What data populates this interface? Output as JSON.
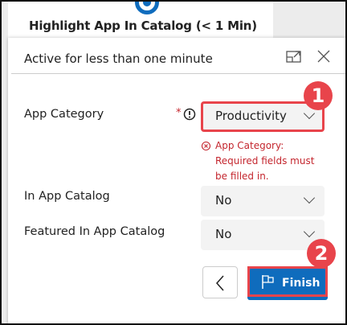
{
  "header": {
    "title": "Highlight App In Catalog  (< 1 Min)"
  },
  "panel": {
    "status": "Active for less than one minute",
    "icons": {
      "expand": "expand-icon",
      "close": "close-icon"
    },
    "fields": [
      {
        "label": "App Category",
        "required": "*",
        "value": "Productivity",
        "error": "App Category: Required fields must be filled in."
      },
      {
        "label": "In App Catalog",
        "value": "No"
      },
      {
        "label": "Featured In App Catalog",
        "value": "No"
      }
    ],
    "finish_label": "Finish",
    "badges": [
      "1",
      "2"
    ]
  },
  "colors": {
    "accent": "#0f6cbd",
    "callout": "#e8444b",
    "error": "#c4262e"
  }
}
